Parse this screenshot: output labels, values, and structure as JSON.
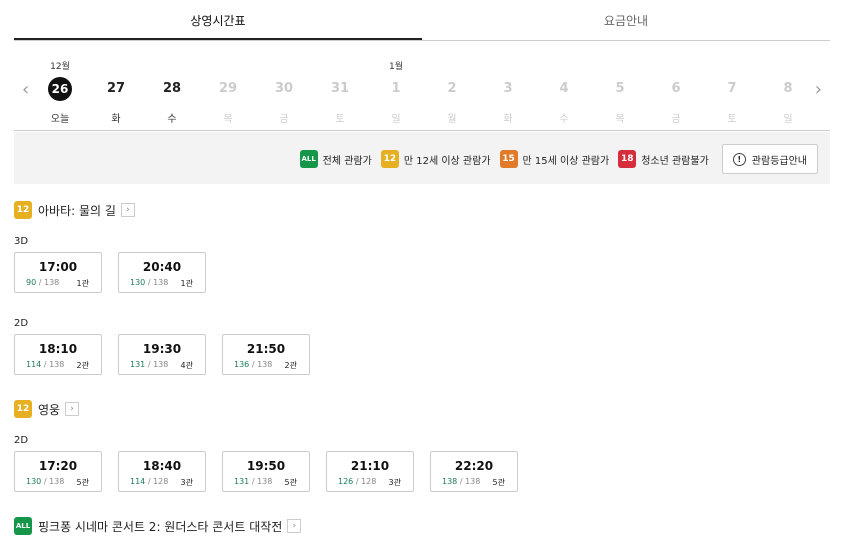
{
  "tabs": [
    {
      "label": "상영시간표",
      "active": true
    },
    {
      "label": "요금안내",
      "active": false
    }
  ],
  "date_strip": {
    "prev_icon": "chevron-left-icon",
    "next_icon": "chevron-right-icon",
    "dates": [
      {
        "month": "12월",
        "day": "26",
        "dow": "오늘",
        "selected": true,
        "disabled": false
      },
      {
        "month": "",
        "day": "27",
        "dow": "화",
        "selected": false,
        "disabled": false
      },
      {
        "month": "",
        "day": "28",
        "dow": "수",
        "selected": false,
        "disabled": false
      },
      {
        "month": "",
        "day": "29",
        "dow": "목",
        "selected": false,
        "disabled": true
      },
      {
        "month": "",
        "day": "30",
        "dow": "금",
        "selected": false,
        "disabled": true
      },
      {
        "month": "",
        "day": "31",
        "dow": "토",
        "selected": false,
        "disabled": true
      },
      {
        "month": "1월",
        "day": "1",
        "dow": "일",
        "selected": false,
        "disabled": true
      },
      {
        "month": "",
        "day": "2",
        "dow": "월",
        "selected": false,
        "disabled": true
      },
      {
        "month": "",
        "day": "3",
        "dow": "화",
        "selected": false,
        "disabled": true
      },
      {
        "month": "",
        "day": "4",
        "dow": "수",
        "selected": false,
        "disabled": true
      },
      {
        "month": "",
        "day": "5",
        "dow": "목",
        "selected": false,
        "disabled": true
      },
      {
        "month": "",
        "day": "6",
        "dow": "금",
        "selected": false,
        "disabled": true
      },
      {
        "month": "",
        "day": "7",
        "dow": "토",
        "selected": false,
        "disabled": true
      },
      {
        "month": "",
        "day": "8",
        "dow": "일",
        "selected": false,
        "disabled": true
      }
    ]
  },
  "ratings": {
    "items": [
      {
        "badge": "ALL",
        "label": "전체 관람가",
        "color": "#159648"
      },
      {
        "badge": "12",
        "label": "만 12세 이상 관람가",
        "color": "#e6b022"
      },
      {
        "badge": "15",
        "label": "만 15세 이상 관람가",
        "color": "#e07b2a"
      },
      {
        "badge": "18",
        "label": "청소년 관람불가",
        "color": "#d62d3c"
      }
    ],
    "guide_button": "관람등급안내"
  },
  "movies": [
    {
      "rating": "12",
      "title": "아바타: 물의 길",
      "formats": [
        {
          "format": "3D",
          "showtimes": [
            {
              "time": "17:00",
              "available": "90",
              "total": "/ 138",
              "hall": "1관"
            },
            {
              "time": "20:40",
              "available": "130",
              "total": "/ 138",
              "hall": "1관"
            }
          ]
        },
        {
          "format": "2D",
          "showtimes": [
            {
              "time": "18:10",
              "available": "114",
              "total": "/ 138",
              "hall": "2관"
            },
            {
              "time": "19:30",
              "available": "131",
              "total": "/ 138",
              "hall": "4관"
            },
            {
              "time": "21:50",
              "available": "136",
              "total": "/ 138",
              "hall": "2관"
            }
          ]
        }
      ]
    },
    {
      "rating": "12",
      "title": "영웅",
      "formats": [
        {
          "format": "2D",
          "showtimes": [
            {
              "time": "17:20",
              "available": "130",
              "total": "/ 138",
              "hall": "5관"
            },
            {
              "time": "18:40",
              "available": "114",
              "total": "/ 128",
              "hall": "3관"
            },
            {
              "time": "19:50",
              "available": "131",
              "total": "/ 138",
              "hall": "5관"
            },
            {
              "time": "21:10",
              "available": "126",
              "total": "/ 128",
              "hall": "3관"
            },
            {
              "time": "22:20",
              "available": "138",
              "total": "/ 138",
              "hall": "5관"
            }
          ]
        }
      ]
    },
    {
      "rating": "ALL",
      "title": "핑크퐁 시네마 콘서트 2: 원더스타 콘서트 대작전",
      "formats": []
    }
  ]
}
